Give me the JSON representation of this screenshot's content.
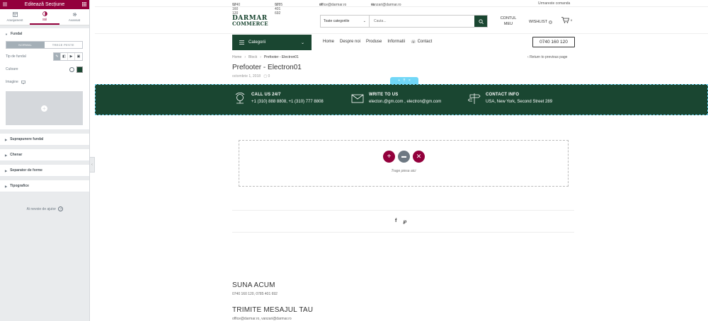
{
  "editor": {
    "title": "Editează Secțiune",
    "tabs": [
      {
        "label": "Aranjament",
        "icon": "layout-icon"
      },
      {
        "label": "Stil",
        "icon": "style-icon"
      },
      {
        "label": "Avansat",
        "icon": "gear-icon"
      }
    ],
    "sections": {
      "fundal": "Fundal",
      "suprapunere": "Suprapunere fundal",
      "chenar": "Chenar",
      "separator": "Separator de forme",
      "tipografie": "Tipografice"
    },
    "state_normal": "NORMAL",
    "state_hover": "TRECE PESTE",
    "bg_type_label": "Tip de fundal",
    "color_label": "Culoare",
    "color_value": "#1a4631",
    "image_label": "Imagine",
    "help": "Ai nevoie de ajutor"
  },
  "site": {
    "topbar": {
      "phone1": "0740 160 120",
      "phone2": "0785 401 692",
      "email1": "office@darmar.ro",
      "email2": "vanzari@darmar.ro",
      "track": "Urmareste comanda"
    },
    "logo": {
      "line1": "DARMAR",
      "line2": "COMMERCE"
    },
    "search": {
      "category": "Toate categoriile",
      "placeholder": "Cauta..."
    },
    "account": {
      "line1": "CONTUL",
      "line2": "MEU"
    },
    "wishlist": "WISHLIST",
    "wishlist_count": "0",
    "cart_count": "0",
    "categories_btn": "Categorii",
    "nav": [
      "Home",
      "Despre noi",
      "Produse",
      "Informatii",
      "Contact"
    ],
    "phone_btn": "0740 160 120",
    "breadcrumb": [
      "Home",
      "Block",
      "Prefooter - Electron01"
    ],
    "back": "Return to previous page",
    "title": "Prefooter - Electron01",
    "date": "octombrie 1, 2018",
    "comments": "0",
    "prefooter": [
      {
        "heading": "CALL US 24/7",
        "value": "+1 (310) 888 8808, +1 (310) 777 8808",
        "icon": "phone-call-icon"
      },
      {
        "heading": "WRITE TO US",
        "value": "electon.@gm.com , electron@gm.com",
        "icon": "envelope-icon"
      },
      {
        "heading": "CONTACT INFO",
        "value": "USA, New York, Second Street 289",
        "icon": "signpost-icon"
      }
    ],
    "dropzone_text": "Trage piesa aici",
    "contact_blocks": [
      {
        "heading": "SUNA ACUM",
        "value": "0740 160 120, 0785 401 692"
      },
      {
        "heading": "TRIMITE MESAJUL TAU",
        "value": "office@darmar.ro, vanzari@darmar.ro"
      }
    ],
    "colors": {
      "brand_green": "#1a4631",
      "editor_red": "#93003c",
      "handle_blue": "#71d7f7"
    }
  }
}
